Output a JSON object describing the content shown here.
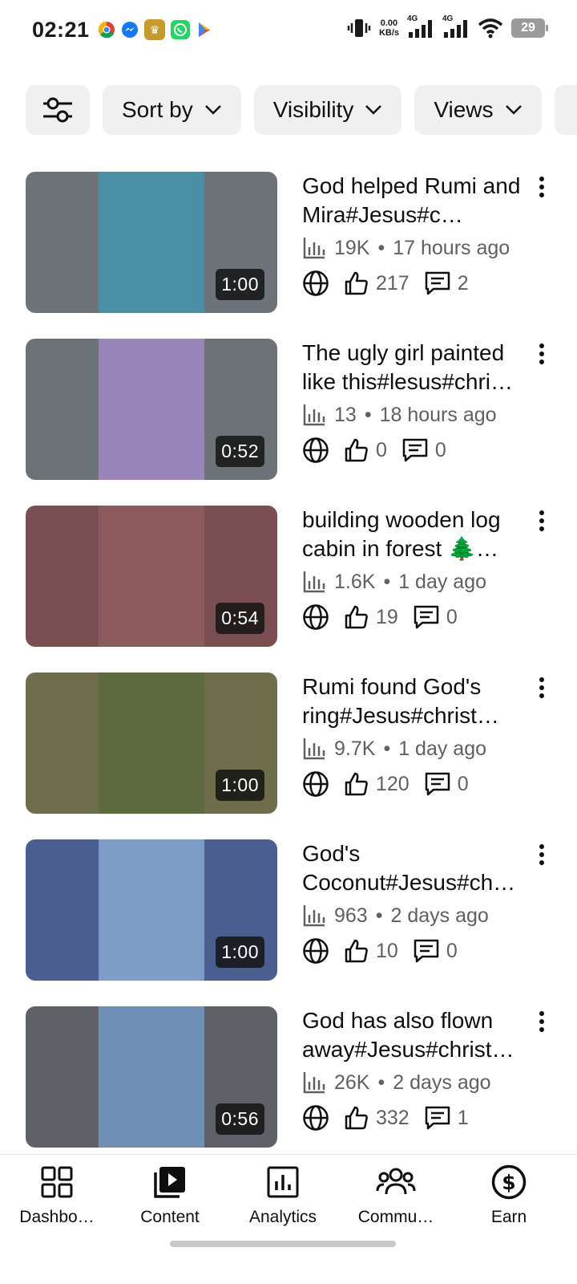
{
  "status_bar": {
    "time": "02:21",
    "net_speed_value": "0.00",
    "net_speed_unit": "KB/s",
    "signal1_label": "4G",
    "signal2_label": "4G",
    "battery": "29"
  },
  "filters": [
    {
      "label": "Sort by"
    },
    {
      "label": "Visibility"
    },
    {
      "label": "Views"
    }
  ],
  "videos": [
    {
      "title": "God helped Rumi and Mira#Jesus#c…",
      "duration": "1:00",
      "views": "19K",
      "age": "17 hours ago",
      "likes": "217",
      "comments": "2",
      "bg": "#6d7479",
      "thumb": "#4a8fa6"
    },
    {
      "title": "The ugly girl painted like this#lesus#chri…",
      "duration": "0:52",
      "views": "13",
      "age": "18 hours ago",
      "likes": "0",
      "comments": "0",
      "bg": "#6b7376",
      "thumb": "#9a85b8"
    },
    {
      "title": "building wooden log cabin in forest 🌲…",
      "duration": "0:54",
      "views": "1.6K",
      "age": "1 day ago",
      "likes": "19",
      "comments": "0",
      "bg": "#7a4f52",
      "thumb": "#8a5a5c"
    },
    {
      "title": "Rumi found God's ring#Jesus#christ…",
      "duration": "1:00",
      "views": "9.7K",
      "age": "1 day ago",
      "likes": "120",
      "comments": "0",
      "bg": "#6e6d4c",
      "thumb": "#5d6a3e"
    },
    {
      "title": "God's Coconut#Jesus#ch…",
      "duration": "1:00",
      "views": "963",
      "age": "2 days ago",
      "likes": "10",
      "comments": "0",
      "bg": "#4a5f8f",
      "thumb": "#7d9cc8"
    },
    {
      "title": "God has also flown away#Jesus#christ…",
      "duration": "0:56",
      "views": "26K",
      "age": "2 days ago",
      "likes": "332",
      "comments": "1",
      "bg": "#5f6068",
      "thumb": "#6f8fb5"
    }
  ],
  "nav": [
    {
      "label": "Dashbo…",
      "icon": "dashboard-icon"
    },
    {
      "label": "Content",
      "icon": "content-icon"
    },
    {
      "label": "Analytics",
      "icon": "analytics-icon"
    },
    {
      "label": "Commu…",
      "icon": "community-icon"
    },
    {
      "label": "Earn",
      "icon": "earn-icon"
    }
  ],
  "colors": {
    "chip_bg": "#f0f0f0",
    "text_primary": "#0f0f0f",
    "text_secondary": "#606060"
  }
}
